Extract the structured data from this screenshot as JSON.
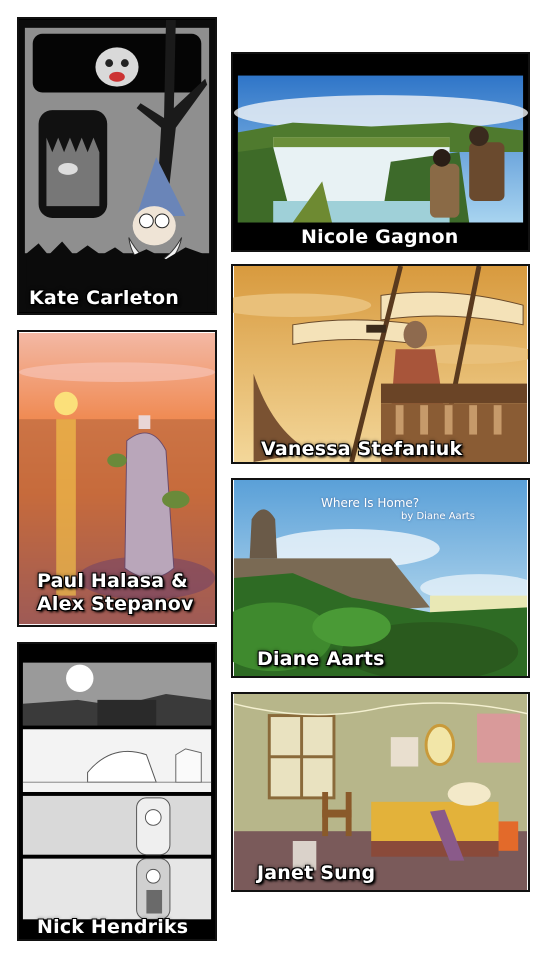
{
  "panels": {
    "kate": {
      "caption": "Kate Carleton"
    },
    "nicole": {
      "caption": "Nicole Gagnon"
    },
    "vanessa": {
      "caption": "Vanessa Stefaniuk"
    },
    "paul": {
      "caption_line1": "Paul Halasa &",
      "caption_line2": "Alex Stepanov"
    },
    "diane": {
      "caption": "Diane Aarts",
      "title_line1": "Where Is Home?",
      "title_line2": "by Diane Aarts"
    },
    "nick": {
      "caption": "Nick Hendriks"
    },
    "janet": {
      "caption": "Janet Sung"
    }
  }
}
